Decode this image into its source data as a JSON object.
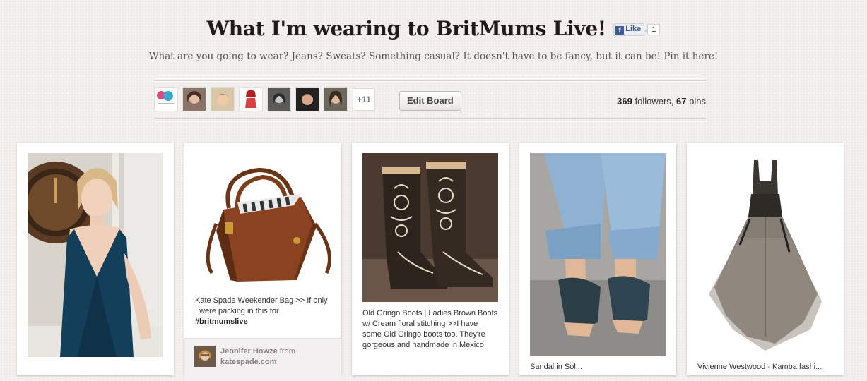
{
  "board": {
    "title": "What I'm wearing to BritMums Live!",
    "description": "What are you going to wear? Jeans? Sweats? Something casual? It doesn't have to be fancy, but it can be! Pin it here!",
    "fb_like_label": "Like",
    "fb_like_count": "1",
    "more_pinners": "+11",
    "edit_label": "Edit Board",
    "followers_count": "369",
    "followers_label": "followers,",
    "pins_count": "67",
    "pins_label": "pins"
  },
  "pins": [
    {
      "description": "",
      "image": "woman in teal dress"
    },
    {
      "description_parts": [
        "Kate Spade Weekender Bag >> If only I were packing in this for ",
        "#britmumslive"
      ],
      "pinner": "Jennifer Howze",
      "from_label": "from",
      "source": "katespade.com",
      "image": "brown leather tote bag"
    },
    {
      "description": "Old Gringo Boots | Ladies Brown Boots w/ Cream floral stitching >>I have some Old Gringo boots too. They're gorgeous and handmade in Mexico",
      "image": "embroidered cowboy boots"
    },
    {
      "description": "Sandal in Sol...",
      "image": "jeans and sandals"
    },
    {
      "description": "Vivienne Westwood - Kamba fashi...",
      "image": "dark tulle dress"
    }
  ],
  "colors": {
    "background": "#f2efec",
    "facebook": "#3b5998",
    "card": "#ffffff"
  }
}
